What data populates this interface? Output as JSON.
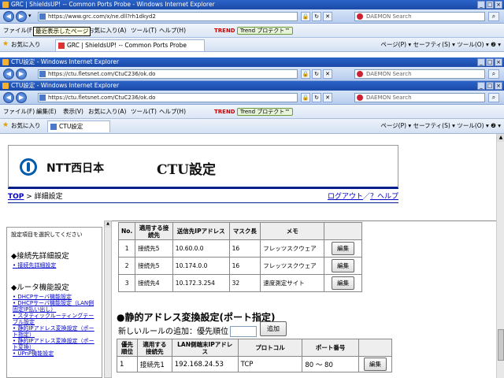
{
  "windows": {
    "grc_title": "GRC | ShieldsUP! -- Common Ports Probe - Windows Internet Explorer",
    "grc_url": "https://www.grc.com/x/ne.dll?rh1dkyd2",
    "ctu1_title": "CTU設定 - Windows Internet Explorer",
    "ctu1_url": "https://ctu.fletsnet.com/CtuC236/ok.do",
    "ctu2_title": "CTU設定 - Windows Internet Explorer",
    "ctu2_url": "https://ctu.fletsnet.com/CtuC236/ok.do",
    "search_placeholder": "DAEMON Search"
  },
  "menus": {
    "file": "ファイル(F)",
    "edit": "編集(E)",
    "view": "表示(V)",
    "favorites": "お気に入り(A)",
    "tools": "ツール(T)",
    "help": "ヘルプ(H)",
    "trend_logo": "TREND",
    "trend_protect": "Trend プロテクト™"
  },
  "tooltip": "最近表示したページ",
  "favbar": {
    "favorites": "お気に入り",
    "grc_tab": "GRC | ShieldsUP! -- Common Ports Probe",
    "ctu_tab": "CTU設定",
    "commands": "ページ(P) ▾  セーフティ(S) ▾  ツール(O) ▾  ❷ ▾"
  },
  "page": {
    "brand": "NTT西日本",
    "title": "CTU設定",
    "crumb_top": "TOP",
    "crumb_sep": " > ",
    "crumb_current": "詳細設定",
    "logout": "ログアウト",
    "help": "？ヘルプ",
    "links_sep": "／"
  },
  "leftnav": {
    "hint": "設定項目を選択してください",
    "section1": "◆接続先詳細設定",
    "link1": "接続先詳細設定",
    "section2": "◆ルータ機能設定",
    "links": [
      "DHCPサーバ機能設定",
      "DHCPサーバ機能設定（LAN側固定IP払い出し）",
      "スタティックルーティングテーブル設定",
      "静的IPアドレス変換設定（ポート指定）",
      "静的IPアドレス変換設定（ポート変換）",
      "UPnP機能設定"
    ]
  },
  "route_table": {
    "headers": [
      "No.",
      "適用する接続先",
      "送信先IPアドレス",
      "マスク長",
      "メモ",
      ""
    ],
    "rows": [
      {
        "no": "1",
        "conn": "接続先5",
        "ip": "10.60.0.0",
        "mask": "16",
        "memo": "フレッツスクウェア",
        "btn": "編集"
      },
      {
        "no": "2",
        "conn": "接続先5",
        "ip": "10.174.0.0",
        "mask": "16",
        "memo": "フレッツスクウェア",
        "btn": "編集"
      },
      {
        "no": "3",
        "conn": "接続先4",
        "ip": "10.172.3.254",
        "mask": "32",
        "memo": "速度測定サイト",
        "btn": "編集"
      }
    ]
  },
  "static_nat": {
    "title": "●静的アドレス変換設定(ポート指定)",
    "new_rule_label": "新しいルールの追加：優先順位",
    "add_button": "追加",
    "headers": [
      "優先順位",
      "適用する接続先",
      "LAN側端末IPアドレス",
      "プロトコル",
      "ポート番号",
      ""
    ],
    "rows": [
      {
        "prio": "1",
        "conn": "接続先1",
        "ip": "192.168.24.53",
        "proto": "TCP",
        "port": "80 〜 80",
        "btn": "編集"
      }
    ]
  }
}
